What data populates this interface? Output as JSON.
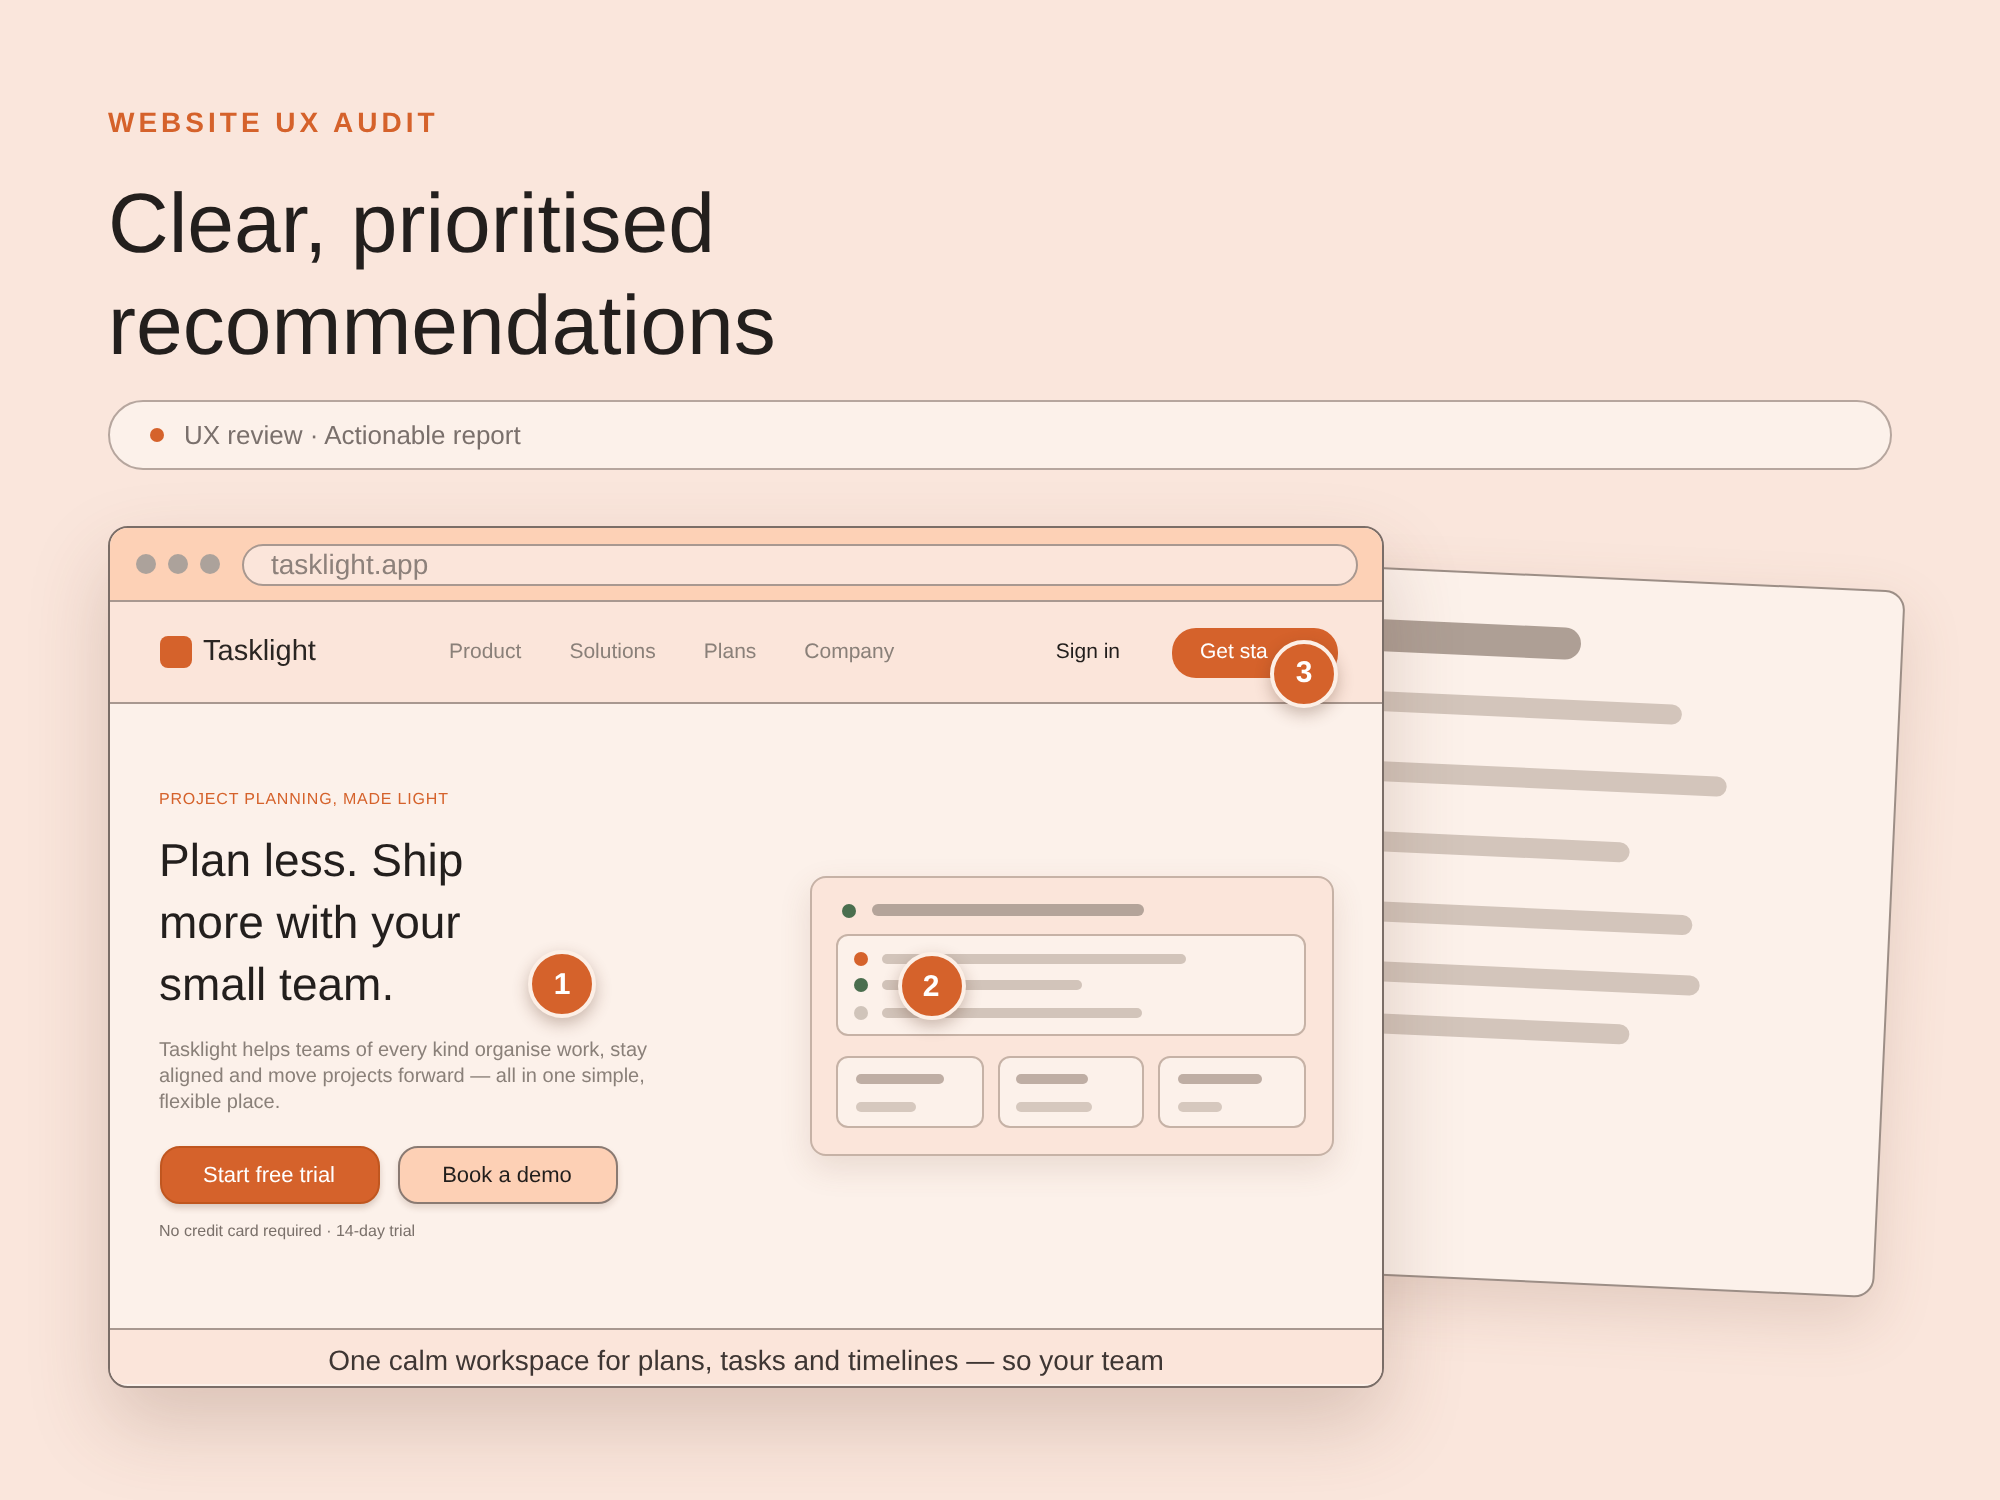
{
  "header": {
    "eyebrow": "WEBSITE UX AUDIT",
    "title": "Clear, prioritised recommendations",
    "tagline": "UX review · Actionable report"
  },
  "browser": {
    "url": "tasklight.app"
  },
  "site_nav": {
    "brand": "Tasklight",
    "links": [
      "Product",
      "Solutions",
      "Plans",
      "Company"
    ],
    "sign_in": "Sign in",
    "cta": "Get sta",
    "cta_marker": "3"
  },
  "hero": {
    "eyebrow": "PROJECT PLANNING, MADE LIGHT",
    "headline": "Plan less. Ship more with your small team.",
    "marker": "1",
    "body": "Tasklight helps teams of every kind organise work, stay aligned and move projects forward — all in one simple, flexible place.",
    "buttons": [
      {
        "label": "Start free trial",
        "kind": "primary"
      },
      {
        "label": "Book a demo",
        "kind": "secondary"
      }
    ],
    "note": "No credit card required · 14-day trial"
  },
  "mockup": {
    "marker": "2",
    "rows": [
      {
        "color": "#d5622b"
      },
      {
        "color": "#4a6e4e"
      },
      {
        "color": "#d0c4ba"
      }
    ]
  },
  "footer": {
    "text": "One calm workspace for plans, tasks and timelines — so your team"
  }
}
